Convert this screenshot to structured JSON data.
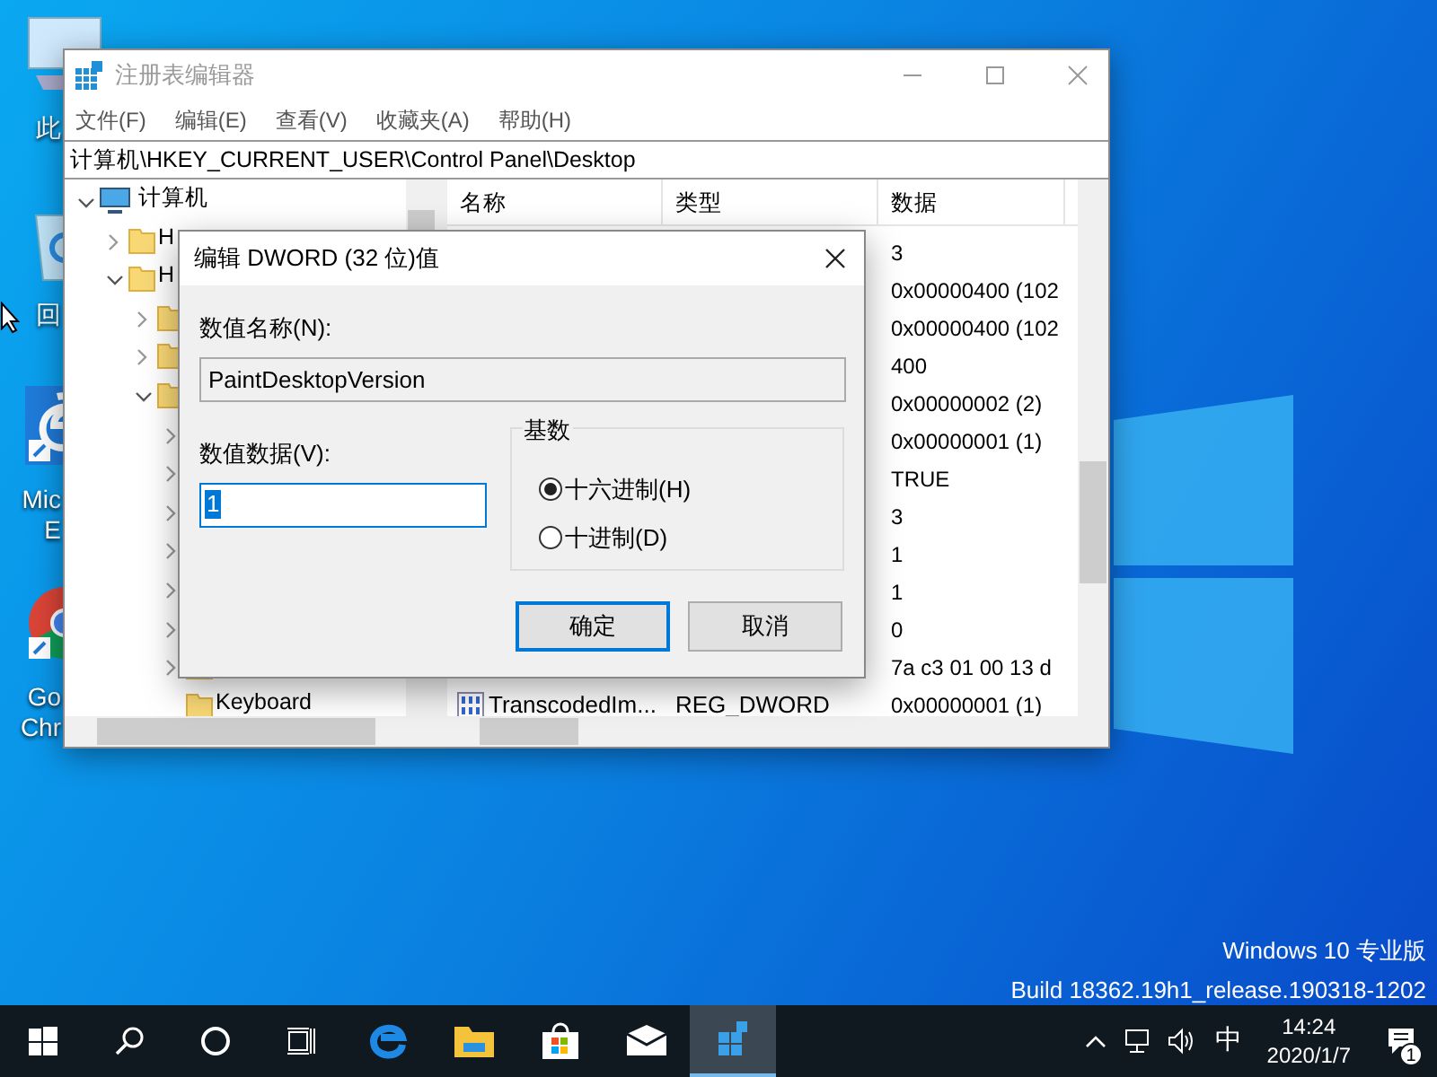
{
  "desktop": {
    "icons": [
      {
        "kind": "pc",
        "lines": [
          "此"
        ]
      },
      {
        "kind": "recycle",
        "lines": [
          "回"
        ]
      },
      {
        "kind": "edge",
        "lines": [
          "Mic",
          "E"
        ]
      },
      {
        "kind": "chrome",
        "lines": [
          "Go",
          "Chr"
        ]
      }
    ],
    "edition": "Windows 10 专业版",
    "build": "Build 18362.19h1_release.190318-1202"
  },
  "regedit": {
    "title": "注册表编辑器",
    "menu": [
      "文件(F)",
      "编辑(E)",
      "查看(V)",
      "收藏夹(A)",
      "帮助(H)"
    ],
    "address": "计算机\\HKEY_CURRENT_USER\\Control Panel\\Desktop",
    "tree": [
      {
        "label": "计算机",
        "kind": "computer",
        "expanded": true,
        "children": [
          {
            "label": "H",
            "expanded": false
          },
          {
            "label": "H",
            "expanded": true,
            "children": [
              {
                "expanded": false
              },
              {
                "expanded": false
              },
              {
                "expanded": true,
                "children": [
                  {
                    "expanded": false
                  },
                  {
                    "expanded": false
                  },
                  {
                    "expanded": false
                  },
                  {
                    "expanded": false
                  },
                  {
                    "expanded": false
                  },
                  {
                    "expanded": false
                  },
                  {
                    "expanded": false
                  },
                  {
                    "label": "Keyboard"
                  }
                ]
              }
            ]
          }
        ]
      }
    ],
    "columns": [
      "名称",
      "类型",
      "数据"
    ],
    "rows": [
      {
        "data": "3"
      },
      {
        "data": "0x00000400 (102"
      },
      {
        "data": "0x00000400 (102"
      },
      {
        "data": "400"
      },
      {
        "data": "0x00000002 (2)"
      },
      {
        "data": "0x00000001 (1)"
      },
      {
        "data": "TRUE"
      },
      {
        "data": "3"
      },
      {
        "data": "1"
      },
      {
        "data": "1"
      },
      {
        "data": "0"
      },
      {
        "data": "7a c3 01 00 13 d"
      },
      {
        "name": "TranscodedIm...",
        "type": "REG_DWORD",
        "data": "0x00000001 (1)"
      }
    ]
  },
  "dialog": {
    "title": "编辑 DWORD (32 位)值",
    "name_label": "数值名称(N):",
    "name_value": "PaintDesktopVersion",
    "data_label": "数值数据(V):",
    "data_value": "1",
    "base_title": "基数",
    "radios": [
      {
        "label": "十六进制(H)",
        "selected": true
      },
      {
        "label": "十进制(D)",
        "selected": false
      }
    ],
    "buttons": [
      {
        "label": "确定",
        "default": true
      },
      {
        "label": "取消",
        "default": false
      }
    ]
  },
  "taskbar": {
    "apps": [
      {
        "kind": "edge",
        "active": false
      },
      {
        "kind": "explorer",
        "active": false
      },
      {
        "kind": "store",
        "active": false
      },
      {
        "kind": "mail",
        "active": false
      },
      {
        "kind": "regedit",
        "active": true
      }
    ],
    "ime": "中",
    "time": "14:24",
    "date": "2020/1/7",
    "notifications": "1"
  }
}
